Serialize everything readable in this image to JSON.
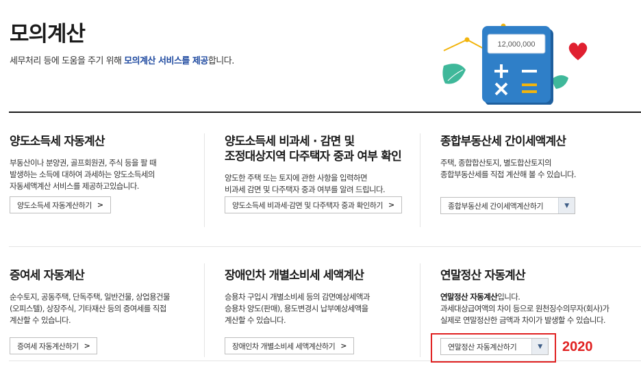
{
  "header": {
    "title": "모의계산",
    "desc_prefix": "세무처리 등에 도움을 주기 위해 ",
    "desc_highlight": "모의계산 서비스를 제공",
    "desc_suffix": "합니다.",
    "hero_amount": "12,000,000"
  },
  "cards": [
    {
      "title": "양도소득세 자동계산",
      "desc": "부동산이나 분양권, 골프회원권, 주식 등을 팔 때\n발생하는 소득에 대하여 과세하는 양도소득세의\n자동세액계산 서비스를 제공하고있습니다.",
      "button": "양도소득세 자동계산하기"
    },
    {
      "title": "양도소득세 비과세 · 감면 및\n조정대상지역 다주택자 중과 여부 확인",
      "desc": "양도한 주택 또는 토지에 관한 사항을 입력하면\n비과세 감면 및 다주택자 중과 여부를 알려 드립니다.",
      "button": "양도소득세 비과세·감면 및 다주택자 중과 확인하기"
    },
    {
      "title": "종합부동산세 간이세액계산",
      "desc": "주택, 종합합산토지, 별도합산토지의\n종합부동산세를 직접 계산해 볼 수 있습니다.",
      "button": "종합부동산세 간이세액계산하기"
    },
    {
      "title": "증여세 자동계산",
      "desc": "순수토지, 공동주택, 단독주택, 일반건물, 상업용건물\n(오피스텔), 상장주식, 기타재산 등의 증여세를 직접\n계산할 수 있습니다.",
      "button": "증여세 자동계산하기"
    },
    {
      "title": "장애인차 개별소비세 세액계산",
      "desc": "승용차 구입시 개별소비세 등의 감면예상세액과\n승용차 양도(판매), 용도변경시 납부예상세액을\n계산할 수 있습니다.",
      "button": "장애인차 개별소비세 세액계산하기"
    },
    {
      "title": "연말정산 자동계산",
      "desc_bold": "연말정산 자동계산",
      "desc_bold_suffix": "입니다.",
      "desc": "과세대상급여액의 차이 등으로 원천징수의무자(회사)가\n실제로 연말정산한 금액과 차이가 발생할 수 있습니다.",
      "button": "연말정산 자동계산하기"
    }
  ],
  "annotation": {
    "year": "2020",
    "color": "#e02020"
  },
  "colors": {
    "highlight": "#1f4aa0",
    "calculator": "#2f7fc8",
    "leaf": "#3fb89a",
    "heart": "#e02030"
  }
}
